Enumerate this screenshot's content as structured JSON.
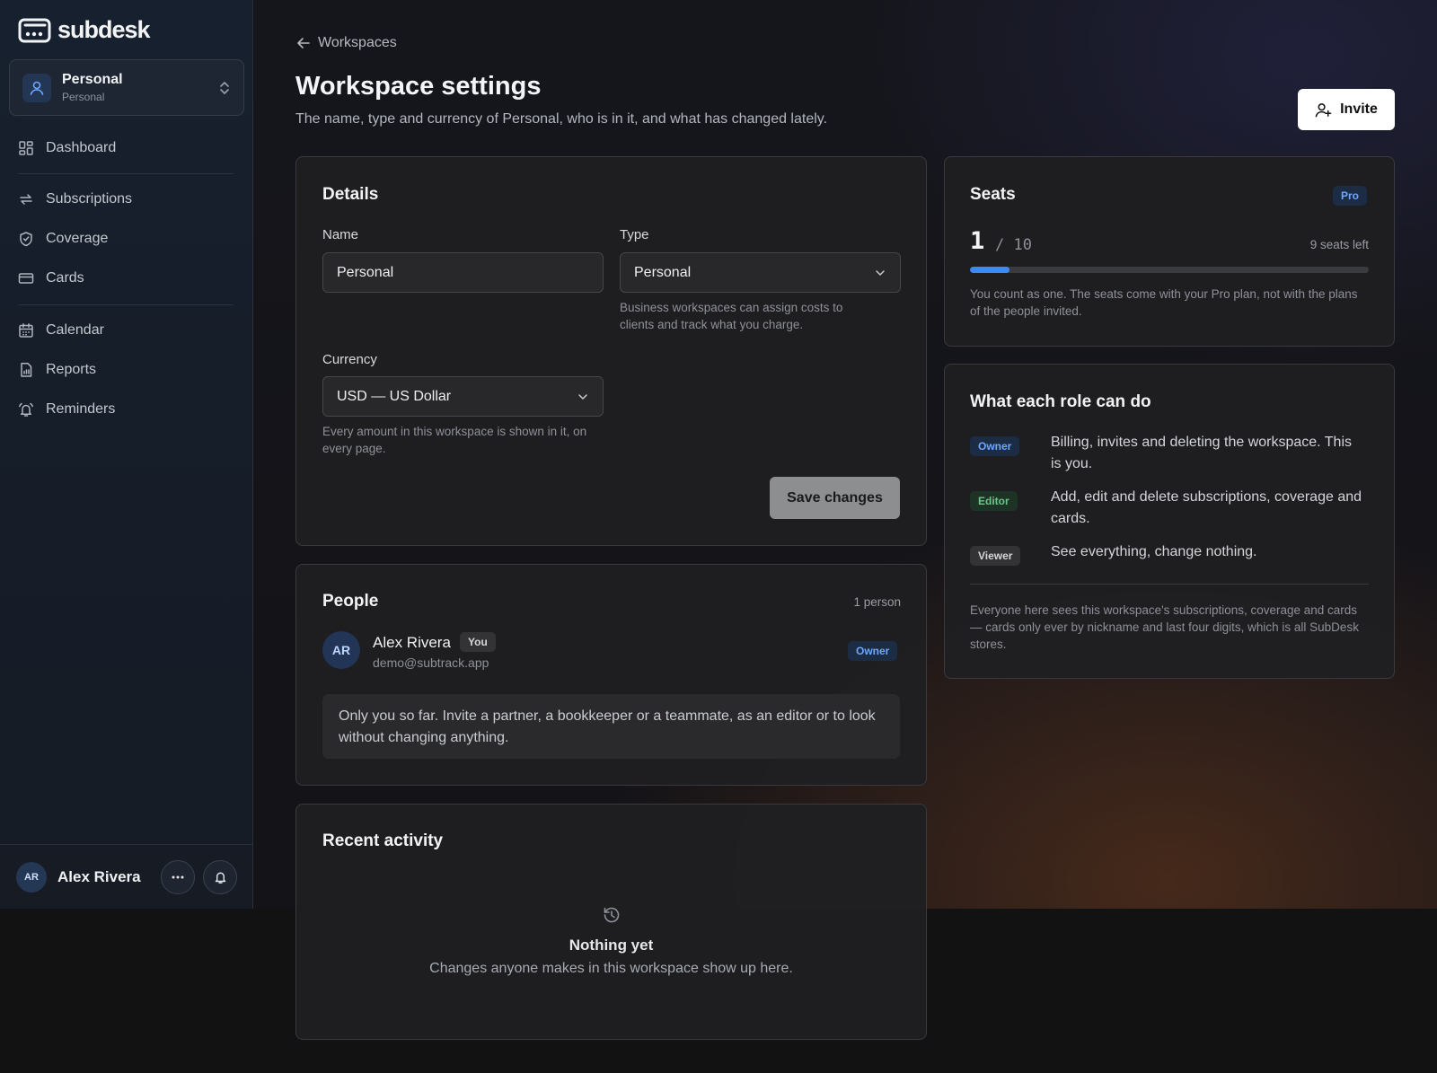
{
  "app": {
    "name": "subdesk"
  },
  "workspace_switcher": {
    "name": "Personal",
    "type": "Personal"
  },
  "sidebar": {
    "items": [
      {
        "label": "Dashboard",
        "icon": "dashboard-icon"
      },
      {
        "label": "Subscriptions",
        "icon": "repeat-icon"
      },
      {
        "label": "Coverage",
        "icon": "shield-icon"
      },
      {
        "label": "Cards",
        "icon": "credit-card-icon"
      },
      {
        "label": "Calendar",
        "icon": "calendar-icon"
      },
      {
        "label": "Reports",
        "icon": "report-icon"
      },
      {
        "label": "Reminders",
        "icon": "bell-ring-icon"
      }
    ],
    "user": {
      "initials": "AR",
      "name": "Alex Rivera"
    }
  },
  "header": {
    "breadcrumb": "Workspaces",
    "title": "Workspace settings",
    "subtitle": "The name, type and currency of Personal, who is in it, and what has changed lately.",
    "invite_label": "Invite"
  },
  "details": {
    "title": "Details",
    "name_label": "Name",
    "name_value": "Personal",
    "type_label": "Type",
    "type_value": "Personal",
    "type_hint": "Business workspaces can assign costs to clients and track what you charge.",
    "currency_label": "Currency",
    "currency_value": "USD — US Dollar",
    "currency_hint": "Every amount in this workspace is shown in it, on every page.",
    "save_label": "Save changes"
  },
  "people": {
    "title": "People",
    "count": "1 person",
    "member": {
      "initials": "AR",
      "name": "Alex Rivera",
      "you_badge": "You",
      "email": "demo@subtrack.app",
      "role": "Owner"
    },
    "empty_note": "Only you so far. Invite a partner, a bookkeeper or a teammate, as an editor or to look without changing anything."
  },
  "activity": {
    "title": "Recent activity",
    "empty_title": "Nothing yet",
    "empty_text": "Changes anyone makes in this workspace show up here."
  },
  "seats": {
    "title": "Seats",
    "plan_badge": "Pro",
    "used": "1",
    "total_text": "/ 10",
    "used_fraction": 0.1,
    "left_text": "9 seats left",
    "note": "You count as one. The seats come with your Pro plan, not with the plans of the people invited."
  },
  "roles": {
    "title": "What each role can do",
    "items": [
      {
        "role": "Owner",
        "text": "Billing, invites and deleting the workspace. This is you."
      },
      {
        "role": "Editor",
        "text": "Add, edit and delete subscriptions, coverage and cards."
      },
      {
        "role": "Viewer",
        "text": "See everything, change nothing."
      }
    ],
    "note": "Everyone here sees this workspace's subscriptions, coverage and cards — cards only ever by nickname and last four digits, which is all SubDesk stores."
  },
  "colors": {
    "accent": "#3d8bf0",
    "owner_badge": "#6ea7ff",
    "editor_badge": "#6cc58a"
  }
}
